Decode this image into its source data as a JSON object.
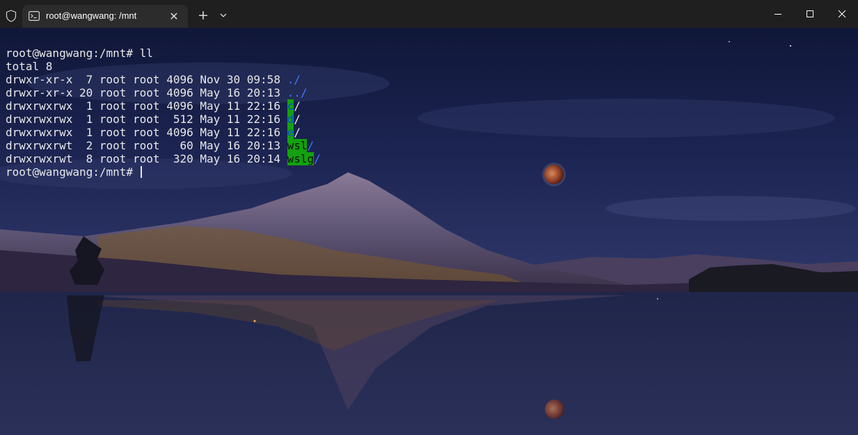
{
  "window": {
    "tab_title": "root@wangwang: /mnt",
    "tab_close_symbol": "✕",
    "new_tab_symbol": "+",
    "minimize_label": "Minimize",
    "maximize_label": "Maximize",
    "close_label": "Close"
  },
  "terminal": {
    "command_line": "root@wangwang:/mnt# ll",
    "total": "total 8",
    "entries": [
      {
        "meta": "drwxr-xr-x  7 root root 4096 Nov 30 09:58 ",
        "name": "./",
        "suffix": ""
      },
      {
        "meta": "drwxr-xr-x 20 root root 4096 May 16 20:13 ",
        "name": "../",
        "suffix": ""
      },
      {
        "meta": "drwxrwxrwx  1 root root 4096 May 11 22:16 ",
        "name": "c",
        "suffix": "/"
      },
      {
        "meta": "drwxrwxrwx  1 root root  512 May 11 22:16 ",
        "name": "d",
        "suffix": "/"
      },
      {
        "meta": "drwxrwxrwx  1 root root 4096 May 11 22:16 ",
        "name": "e",
        "suffix": "/"
      },
      {
        "meta": "drwxrwxrwt  2 root root   60 May 16 20:13 ",
        "name": "wsl",
        "suffix": "/"
      },
      {
        "meta": "drwxrwxrwt  8 root root  320 May 16 20:14 ",
        "name": "wslg",
        "suffix": "/"
      }
    ],
    "prompt": "root@wangwang:/mnt# "
  },
  "colors": {
    "dir_blue": "#3b78ff",
    "highlight_green": "#13a10e",
    "text": "#e8e8e8",
    "titlebar": "#1f1f1f"
  },
  "icons": [
    "shield-icon",
    "terminal-icon",
    "close-icon",
    "plus-icon",
    "chevron-down-icon",
    "minimize-icon",
    "maximize-icon",
    "window-close-icon"
  ]
}
